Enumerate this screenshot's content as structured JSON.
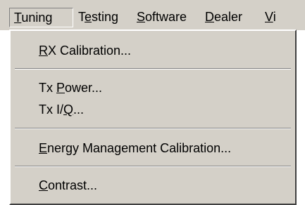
{
  "menubar": {
    "items": [
      {
        "label": "Tuning",
        "hotkey": "T",
        "state": "open"
      },
      {
        "label": "Testing",
        "hotkey": "e"
      },
      {
        "label": "Software",
        "hotkey": "S"
      },
      {
        "label": "Dealer",
        "hotkey": "D"
      },
      {
        "label": "Vi",
        "hotkey": "V"
      }
    ]
  },
  "dropdown": {
    "items": [
      {
        "label": "RX Calibration...",
        "hotkey": "R"
      },
      {
        "label": "Tx Power...",
        "hotkey": "P"
      },
      {
        "label": "Tx I/Q...",
        "hotkey": "Q"
      },
      {
        "label": "Energy Management Calibration...",
        "hotkey": "E"
      },
      {
        "label": "Contrast...",
        "hotkey": "C"
      }
    ]
  },
  "colors": {
    "face": "#d4d0c8",
    "shadow": "#808080",
    "highlight": "#ffffff"
  }
}
